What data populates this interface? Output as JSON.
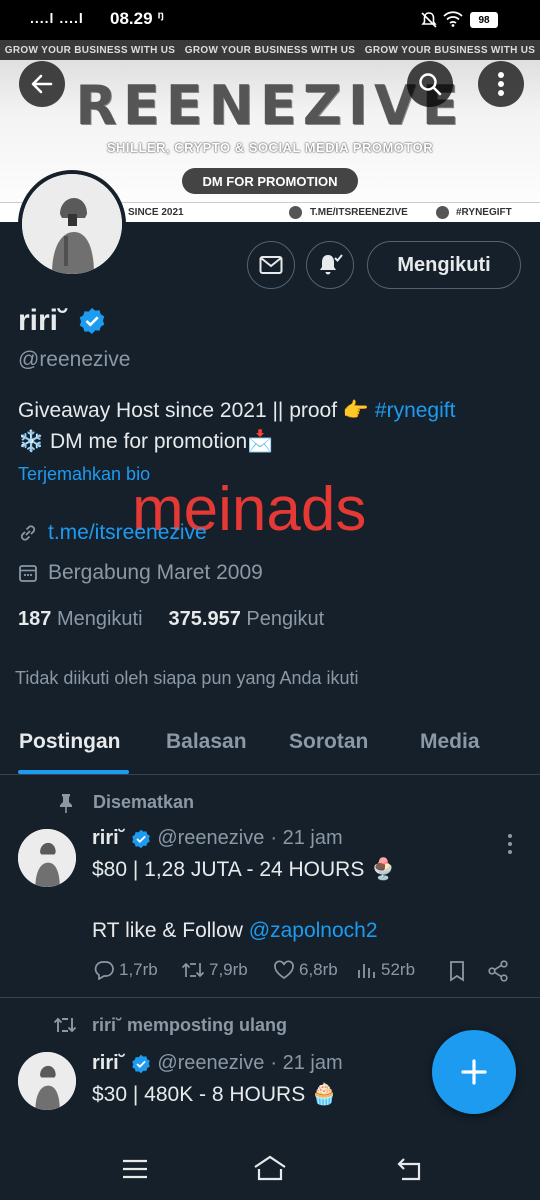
{
  "status_bar": {
    "signal": "....l ....l",
    "time": "08.29",
    "battery": "98"
  },
  "banner": {
    "strip_text": [
      "GROW YOUR BUSINESS WITH US",
      "GROW YOUR BUSINESS WITH US",
      "GROW YOUR BUSINESS WITH US"
    ],
    "brand": "REENEZIVE",
    "tagline": "SHILLER, CRYPTO & SOCIAL MEDIA PROMOTOR",
    "dm_pill": "DM FOR PROMOTION",
    "since": "SINCE 2021",
    "telegram": "T.ME/ITSREENEZIVE",
    "hashtag": "#RYNEGIFT"
  },
  "profile": {
    "follow_label": "Mengikuti",
    "name": "riri˘",
    "handle": "@reenezive",
    "bio_line1_text": "Giveaway Host since 2021 || proof 👉",
    "bio_line1_tag": "#rynegift",
    "bio_line2": "❄️ DM me for promotion📩",
    "translate_bio": "Terjemahkan bio",
    "watermark": "meinads",
    "link": "t.me/itsreenezive",
    "joined": "Bergabung Maret 2009",
    "following_count": "187",
    "following_label": "Mengikuti",
    "followers_count": "375.957",
    "followers_label": "Pengikut",
    "not_followed_note": "Tidak diikuti oleh siapa pun yang Anda ikuti"
  },
  "tabs": [
    "Postingan",
    "Balasan",
    "Sorotan",
    "Media"
  ],
  "posts": [
    {
      "context": "Disematkan",
      "name": "riri˘",
      "handle": "@reenezive",
      "time": "· 21 jam",
      "text_line1": "$80 | 1,28 JUTA - 24 HOURS 🍨",
      "text_line2_prefix": "RT like & Follow",
      "text_line2_mention": "@zapolnoch2",
      "replies": "1,7rb",
      "reposts": "7,9rb",
      "likes": "6,8rb",
      "views": "52rb"
    },
    {
      "context": "riri˘ memposting ulang",
      "name": "riri˘",
      "handle": "@reenezive",
      "time": "· 21 jam",
      "text_line1": "$30 | 480K - 8 HOURS 🧁"
    }
  ],
  "colors": {
    "background": "#15202b",
    "accent": "#1d9bf0",
    "muted": "#8b98a5",
    "watermark": "#e53935"
  }
}
